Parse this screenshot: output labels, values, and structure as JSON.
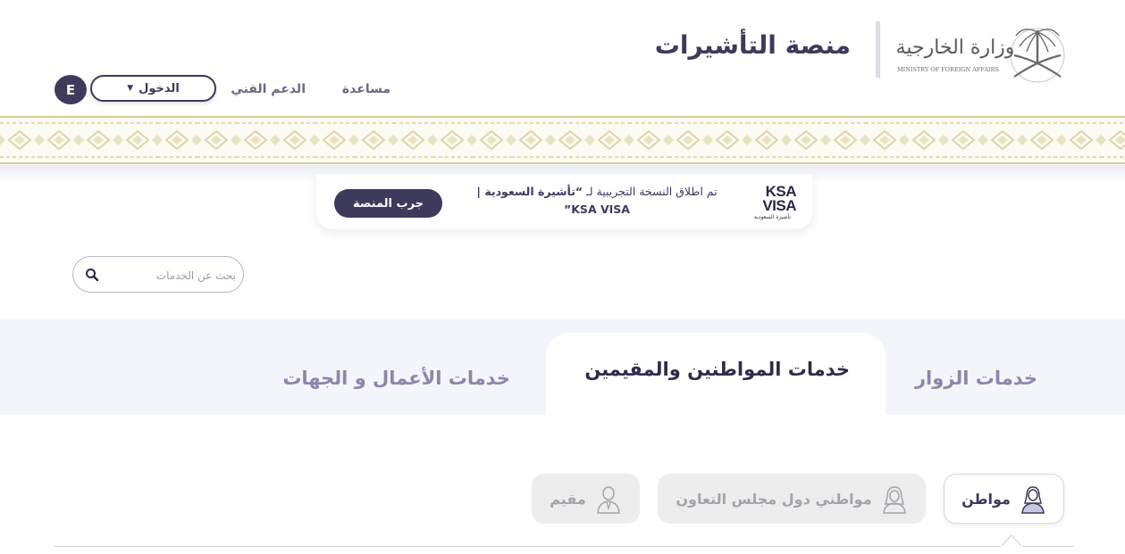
{
  "header": {
    "ministry_name_ar": "وزارة الخارجية",
    "ministry_name_en": "MINISTRY OF FOREIGN AFFAIRS",
    "platform_title": "منصة التأشيرات",
    "nav": {
      "help": "مساعدة",
      "support": "الدعم الفني",
      "login": "الدخول",
      "lang": "E"
    }
  },
  "announcement": {
    "logo_top": "KSA",
    "logo_bottom": "VISA",
    "logo_sub": "تأشيرة السعودية",
    "text_prefix": "تم اطلاق النسخة التجريبية لـ ",
    "text_bold": "“تأشيرة السعودية |",
    "text_line2": "KSA VISA”",
    "button": "جرب المنصة"
  },
  "search": {
    "placeholder": "بحث عن الخدمات"
  },
  "tabs": [
    {
      "label": "خدمات الزوار",
      "active": false
    },
    {
      "label": "خدمات المواطنين والمقيمين",
      "active": true
    },
    {
      "label": "خدمات الأعمال و الجهات",
      "active": false
    }
  ],
  "categories": [
    {
      "label": "مواطن",
      "icon": "citizen-icon",
      "active": true
    },
    {
      "label": "مواطني دول مجلس التعاون",
      "icon": "gcc-citizen-icon",
      "active": false
    },
    {
      "label": "مقيم",
      "icon": "resident-icon",
      "active": false
    }
  ],
  "colors": {
    "primary": "#3d3a5c",
    "tab_bg": "#f4f4fb",
    "band_gold": "#d8cf9a",
    "muted": "#8a88a8"
  }
}
